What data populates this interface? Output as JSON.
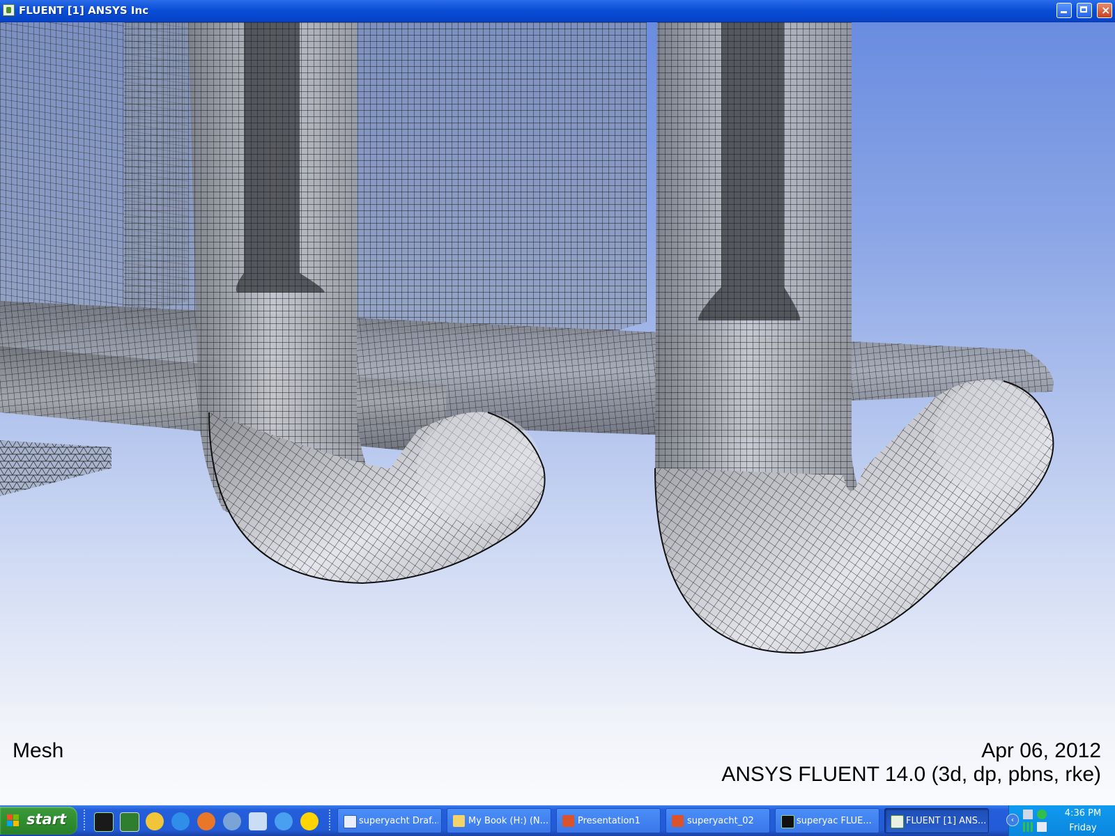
{
  "window": {
    "title": "FLUENT [1] ANSYS Inc"
  },
  "caption": {
    "left": "Mesh",
    "date": "Apr 06, 2012",
    "version": "ANSYS FLUENT 14.0 (3d, dp, pbns, rke)"
  },
  "taskbar": {
    "start_label": "start",
    "quick_launch": [
      "monitor-icon",
      "gambit-icon",
      "folder-icon",
      "internet-explorer-icon",
      "firefox-icon",
      "outlook-icon",
      "notes-icon",
      "media-player-icon",
      "arrow-app-icon"
    ],
    "tasks": [
      {
        "label": "superyacht Draf...",
        "icon": "word-icon"
      },
      {
        "label": "My Book (H:) (N...",
        "icon": "folder-icon"
      },
      {
        "label": "Presentation1",
        "icon": "powerpoint-icon"
      },
      {
        "label": "superyacht_02",
        "icon": "powerpoint-icon"
      },
      {
        "label": "superyac FLUE...",
        "icon": "fluent-graphics-icon"
      },
      {
        "label": "FLUENT [1] ANS...",
        "icon": "fluent-icon",
        "active": true
      }
    ],
    "tray": {
      "time": "4:36 PM",
      "day": "Friday"
    }
  },
  "colors": {
    "titlebar": "#0542c6",
    "taskbar": "#245edb",
    "start_green": "#2f8f2f",
    "tray": "#0b86dd",
    "mesh_line": "#1a1a1a"
  }
}
